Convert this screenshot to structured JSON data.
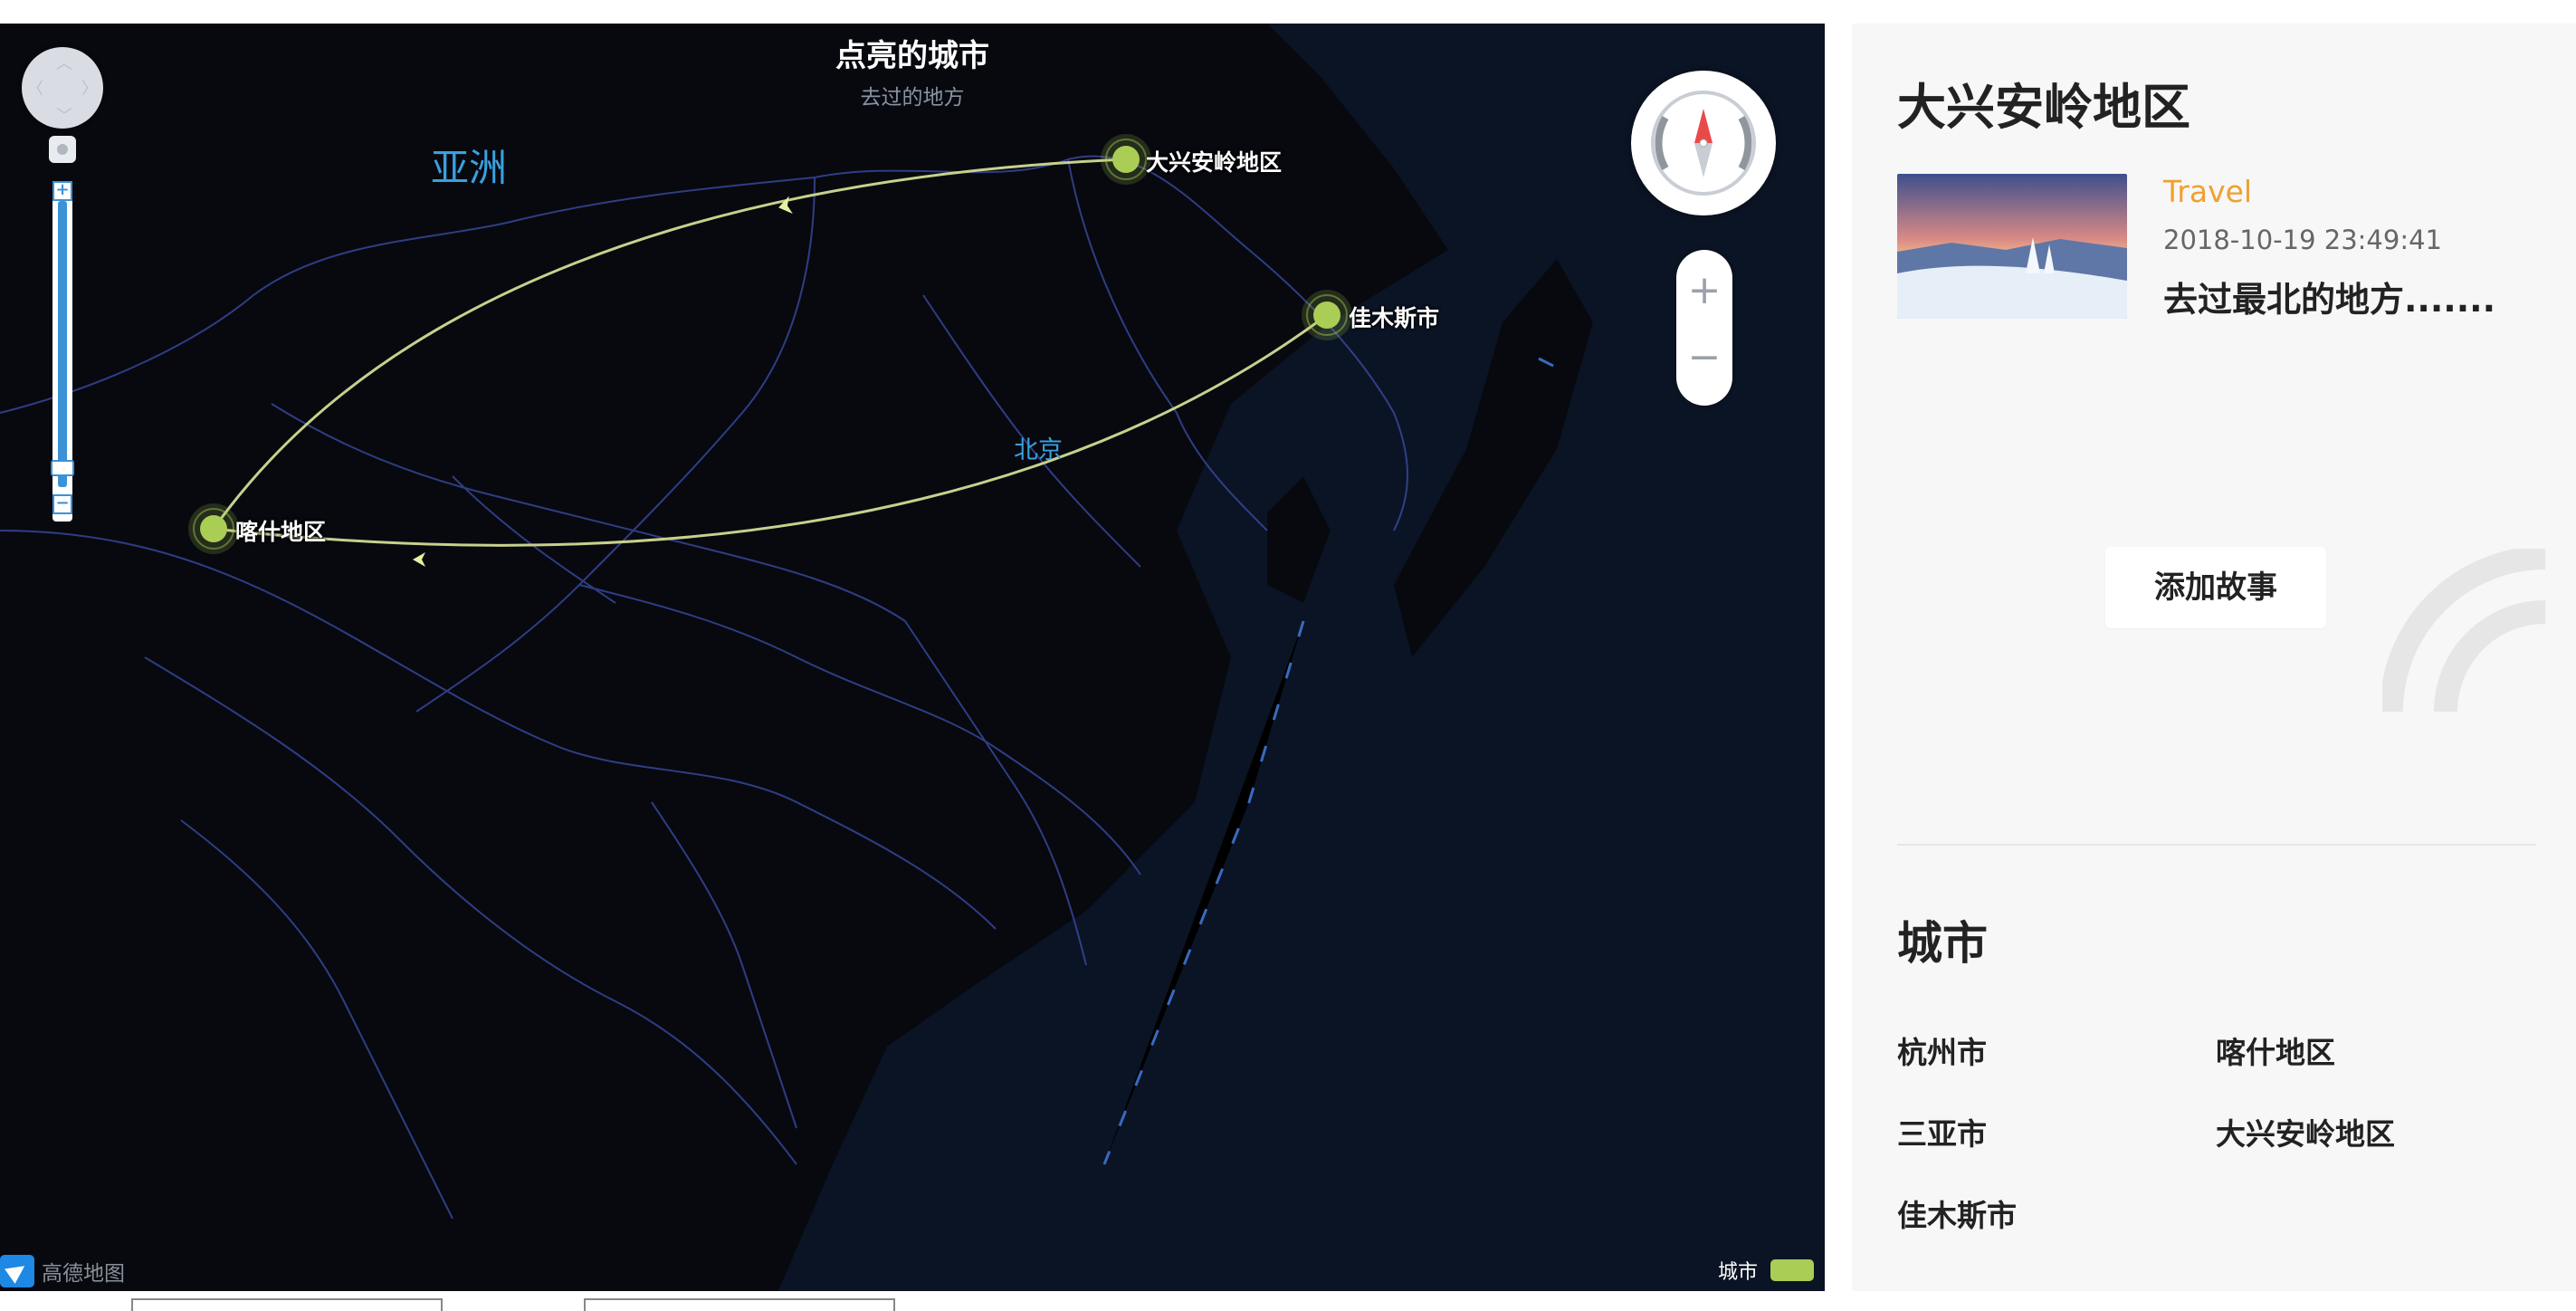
{
  "map": {
    "title": "点亮的城市",
    "subtitle": "去过的地方",
    "continent_label": "亚洲",
    "capital_label": "北京",
    "cities": [
      {
        "name": "大兴安岭地区"
      },
      {
        "name": "佳木斯市"
      },
      {
        "name": "喀什地区"
      }
    ],
    "brand": "高德地图",
    "legend_label": "城市",
    "colors": {
      "background": "#0b1424",
      "border": "#3a4aa0",
      "city_marker": "#aacd55",
      "route": "#c8d08c"
    },
    "controls": {
      "zoom_in": "+",
      "zoom_out": "−"
    }
  },
  "sidebar": {
    "region_title": "大兴安岭地区",
    "story": {
      "category": "Travel",
      "time": "2018-10-19 23:49:41",
      "text": "去过最北的地方......."
    },
    "add_story_button": "添加故事",
    "cities_title": "城市",
    "city_list": [
      "杭州市",
      "喀什地区",
      "三亚市",
      "大兴安岭地区",
      "佳木斯市"
    ],
    "colors": {
      "category": "#f0a030"
    }
  }
}
